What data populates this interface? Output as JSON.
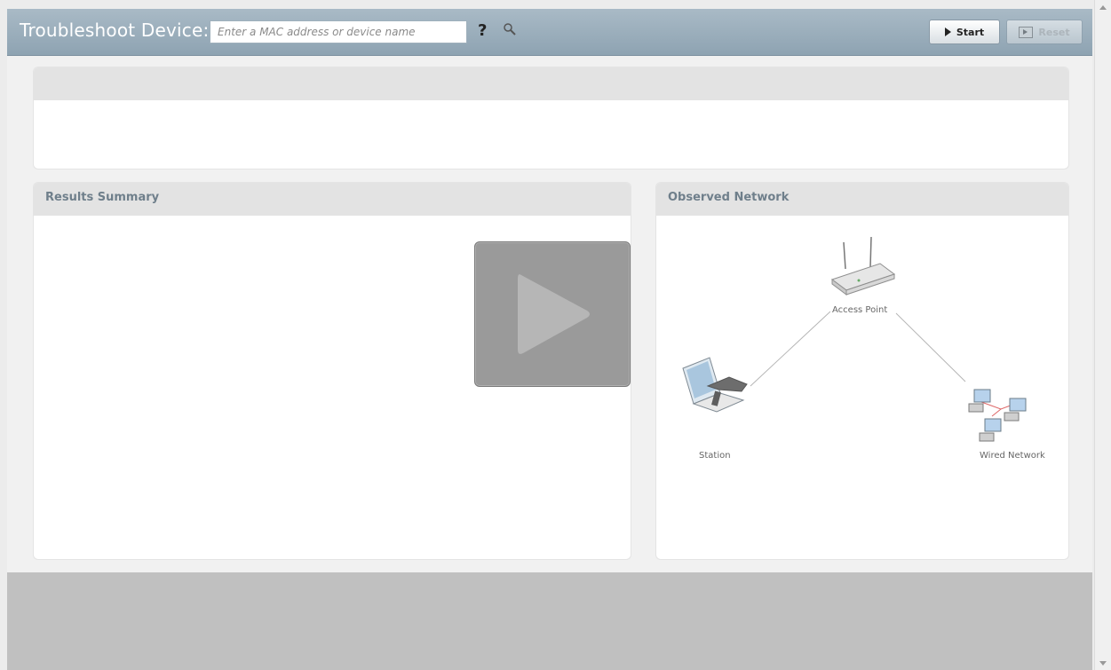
{
  "header": {
    "title": "Troubleshoot Device:",
    "search_placeholder": "Enter a MAC address or device name",
    "help_symbol": "?",
    "start_label": "Start",
    "reset_label": "Reset"
  },
  "panels": {
    "top_title": "",
    "results_title": "Results Summary",
    "network_title": "Observed Network"
  },
  "network": {
    "access_point": "Access Point",
    "station": "Station",
    "wired": "Wired Network"
  },
  "icons": {
    "help": "help-icon",
    "search": "magnifier-icon",
    "start": "play-triangle-icon",
    "reset": "reset-icon",
    "video": "video-play-icon",
    "access_point": "wireless-router-icon",
    "station": "laptop-scanner-icon",
    "wired": "networked-computers-icon"
  }
}
